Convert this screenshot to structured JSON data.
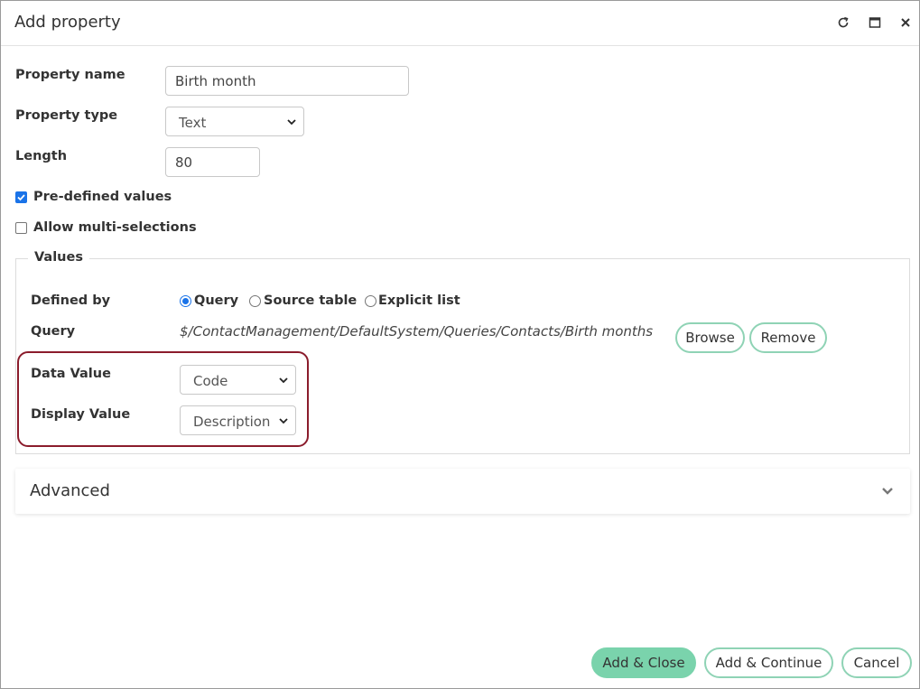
{
  "dialog": {
    "title": "Add property",
    "icons": [
      "refresh-icon",
      "maximize-icon",
      "close-icon"
    ]
  },
  "form": {
    "property_name_label": "Property name",
    "property_name_value": "Birth month",
    "property_type_label": "Property type",
    "property_type_value": "Text",
    "length_label": "Length",
    "length_value": "80",
    "predefined_label": "Pre-defined values",
    "predefined_checked": true,
    "multi_label": "Allow multi-selections",
    "multi_checked": false
  },
  "values": {
    "legend": "Values",
    "defined_by_label": "Defined by",
    "options": [
      {
        "label": "Query",
        "selected": true
      },
      {
        "label": "Source table",
        "selected": false
      },
      {
        "label": "Explicit list",
        "selected": false
      }
    ],
    "query_label": "Query",
    "query_path": "$/ContactManagement/DefaultSystem/Queries/Contacts/Birth months",
    "browse_label": "Browse",
    "remove_label": "Remove",
    "data_value_label": "Data Value",
    "data_value": "Code",
    "display_value_label": "Display Value",
    "display_value": "Description"
  },
  "advanced": {
    "title": "Advanced"
  },
  "footer": {
    "add_close": "Add & Close",
    "add_continue": "Add & Continue",
    "cancel": "Cancel"
  },
  "colors": {
    "accent": "#1a73e8",
    "primary_button": "#7ad3ac",
    "button_border": "#8fd3b5",
    "highlight": "#8b1c2c"
  }
}
